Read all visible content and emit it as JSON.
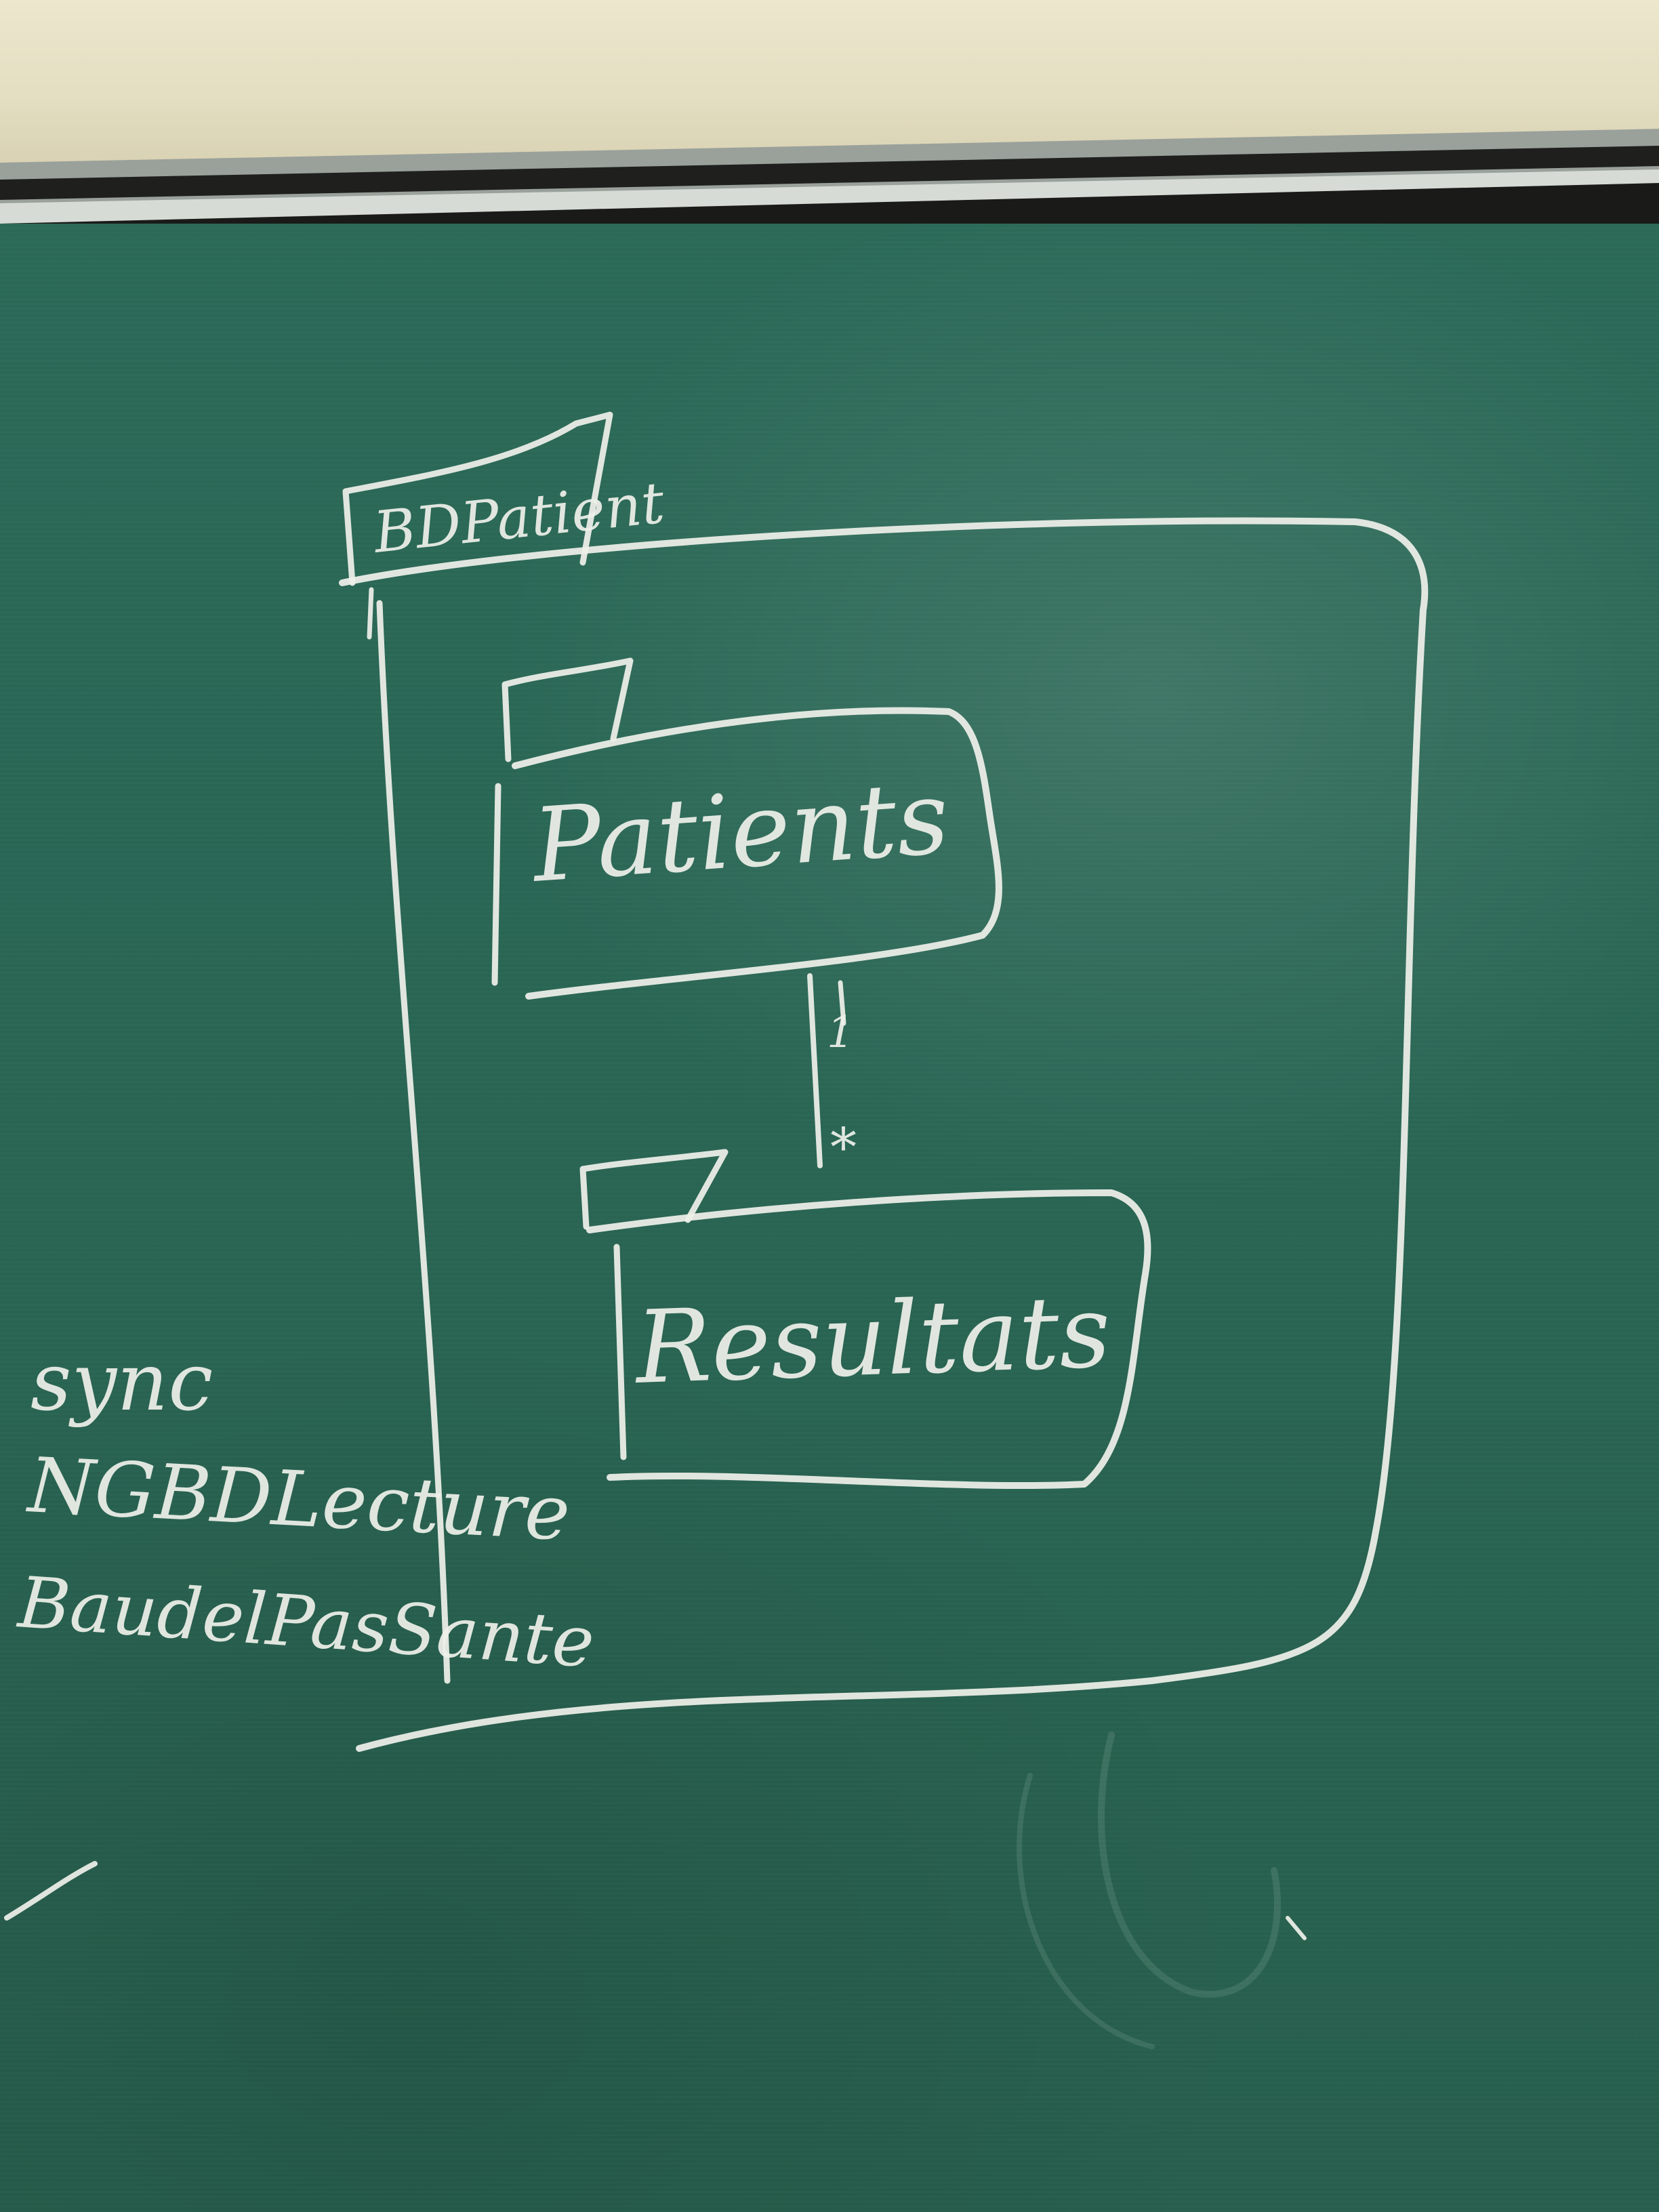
{
  "diagram": {
    "outer_package_label": "BDPatient",
    "package_patients_label": "Patients",
    "package_resultats_label": "Resultats",
    "multiplicity_top": "1",
    "multiplicity_bottom": "*"
  },
  "notes": {
    "line1": "sync",
    "line2": "NGBDLecture",
    "line3": "BaudelPasSante"
  },
  "colors": {
    "chalkboard": "#2a6654",
    "chalk": "#eef0ea",
    "wall": "#e9e4c9",
    "frame": "#1e1f1d"
  }
}
